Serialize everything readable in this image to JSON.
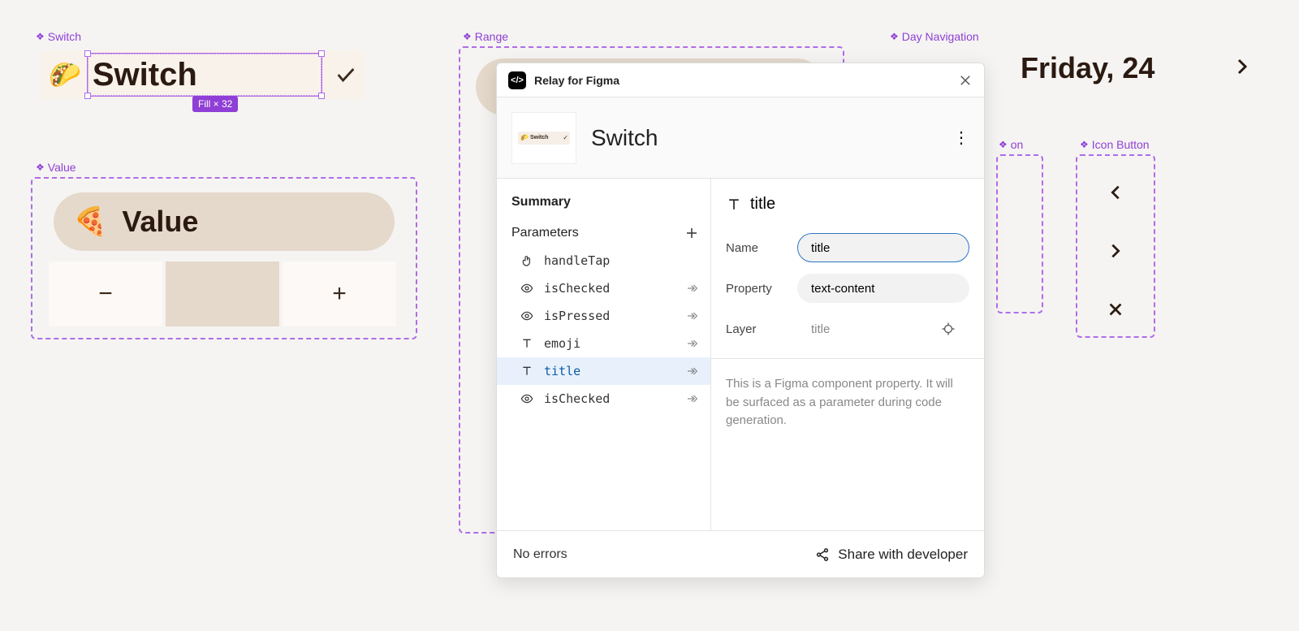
{
  "canvas": {
    "switch": {
      "label": "Switch",
      "emoji": "🌮",
      "title": "Switch",
      "selection_badge": "Fill × 32"
    },
    "value": {
      "label": "Value",
      "emoji": "🍕",
      "title": "Value",
      "minus": "−",
      "plus": "+"
    },
    "range": {
      "label": "Range"
    },
    "day_nav": {
      "label": "Day Navigation",
      "text": "Friday, 24"
    },
    "on_label": "on",
    "icon_button": {
      "label": "Icon Button"
    }
  },
  "panel": {
    "app_title": "Relay for Figma",
    "component_name": "Switch",
    "thumb_text": "Switch",
    "left": {
      "summary": "Summary",
      "parameters_label": "Parameters",
      "params": [
        {
          "icon": "tap",
          "name": "handleTap",
          "arrow": false
        },
        {
          "icon": "eye",
          "name": "isChecked",
          "arrow": true
        },
        {
          "icon": "eye",
          "name": "isPressed",
          "arrow": true
        },
        {
          "icon": "text",
          "name": "emoji",
          "arrow": true
        },
        {
          "icon": "text",
          "name": "title",
          "arrow": true,
          "selected": true
        },
        {
          "icon": "eye",
          "name": "isChecked",
          "arrow": true
        }
      ]
    },
    "right": {
      "heading": "title",
      "name_label": "Name",
      "name_value": "title",
      "property_label": "Property",
      "property_value": "text-content",
      "layer_label": "Layer",
      "layer_value": "title",
      "description": "This is a Figma component property. It will be surfaced as a parameter during code generation."
    },
    "footer": {
      "status": "No errors",
      "share": "Share with developer"
    }
  }
}
